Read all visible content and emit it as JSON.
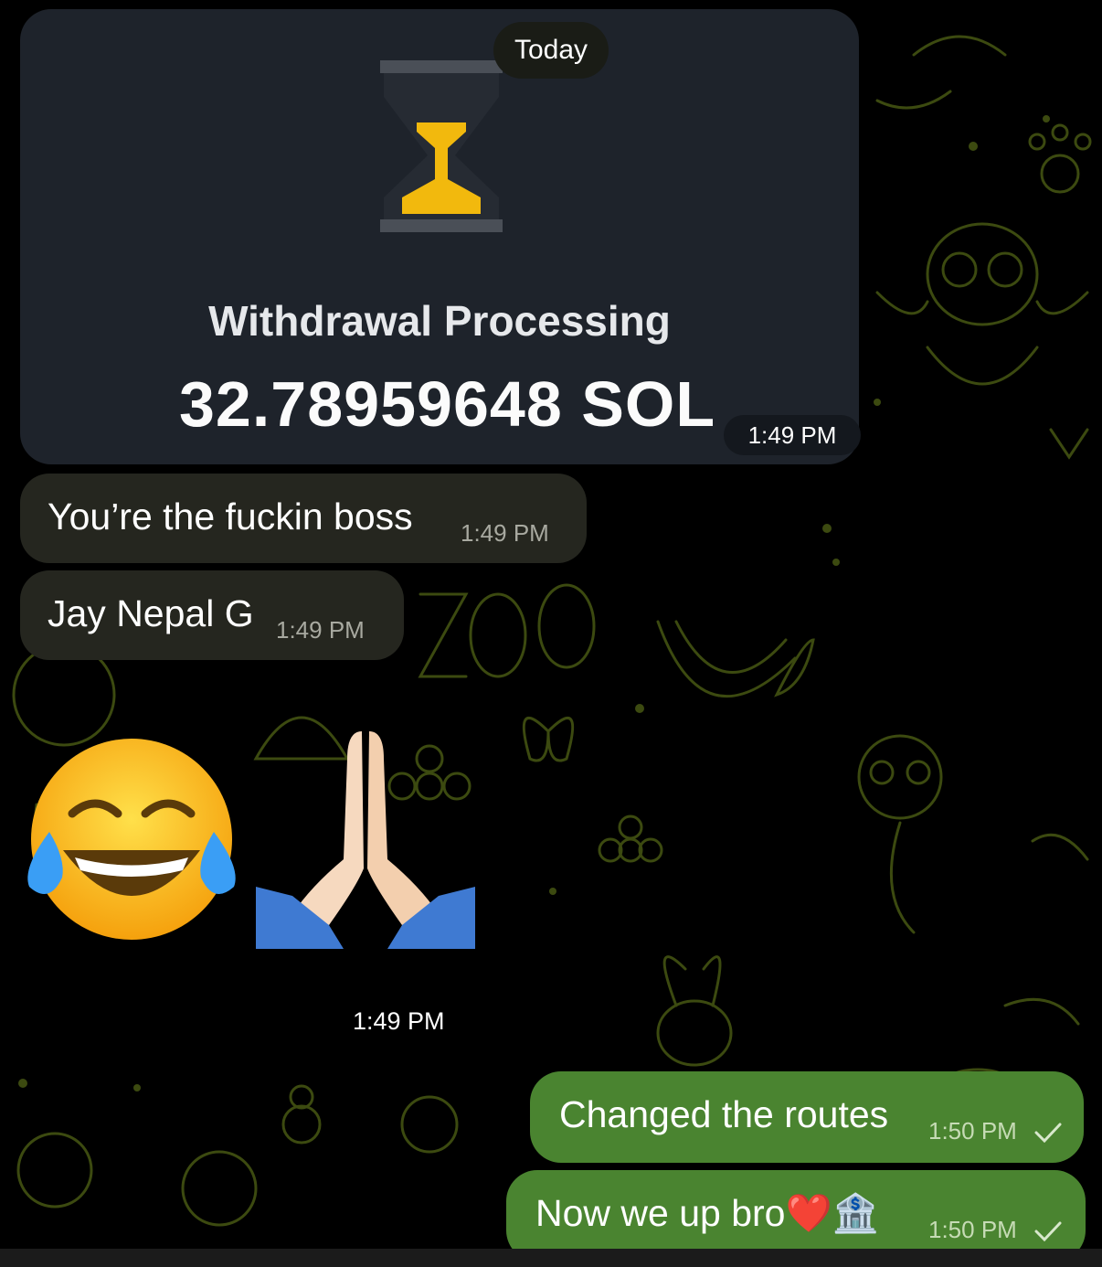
{
  "chat": {
    "date_label": "Today",
    "withdrawal_card": {
      "title": "Withdrawal Processing",
      "amount": "32.78959648 SOL",
      "time": "1:49 PM",
      "icon": "hourglass-icon"
    },
    "messages": [
      {
        "direction": "in",
        "text": "You’re the fuckin boss",
        "time": "1:49 PM"
      },
      {
        "direction": "in",
        "text": "Jay Nepal G",
        "time": "1:49 PM"
      },
      {
        "direction": "in",
        "sticker": "😂🙏",
        "time": "1:49 PM"
      },
      {
        "direction": "out",
        "text": "Changed the routes",
        "time": "1:50 PM",
        "status": "sent"
      },
      {
        "direction": "out",
        "text": "Now we up bro❤️🏦",
        "time": "1:50 PM",
        "status": "sent"
      }
    ]
  },
  "colors": {
    "incoming_bubble": "#25261f",
    "outgoing_bubble": "#4a8430",
    "card_background": "#1e232b",
    "hourglass_accent": "#f2b90d",
    "wallpaper_doodle": "#3d4a0f"
  }
}
